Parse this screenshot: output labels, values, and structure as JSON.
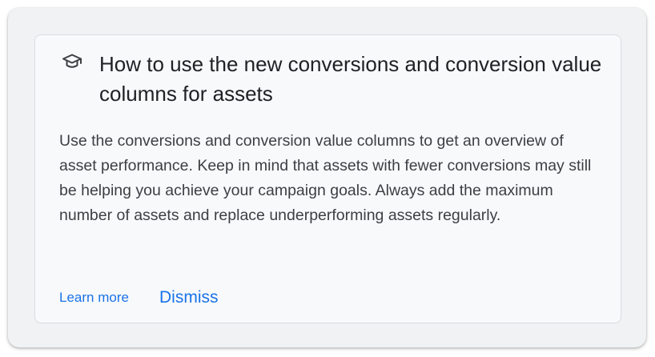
{
  "tip_card": {
    "icon": "graduation-cap-icon",
    "title": "How to use the new conversions and conversion value columns for assets",
    "body": "Use the conversions and conversion value columns to get an overview of asset performance. Keep in mind that assets with fewer conversions may still be helping you achieve your campaign goals. Always add the maximum number of assets and replace underperforming assets regularly.",
    "learn_more_label": "Learn more",
    "dismiss_label": "Dismiss"
  },
  "colors": {
    "accent": "#1a73e8",
    "title_text": "#202124",
    "body_text": "#3c4043",
    "card_background": "#f8f9fb",
    "outer_background": "#f1f2f3"
  }
}
